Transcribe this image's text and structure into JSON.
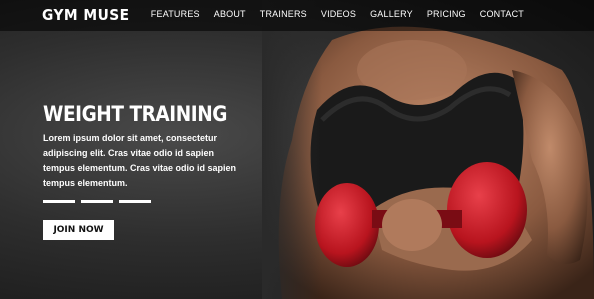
{
  "brand": {
    "name": "GYM MUSE"
  },
  "nav": {
    "items": [
      {
        "label": "FEATURES"
      },
      {
        "label": "ABOUT"
      },
      {
        "label": "TRAINERS"
      },
      {
        "label": "VIDEOS"
      },
      {
        "label": "GALLERY"
      },
      {
        "label": "PRICING"
      },
      {
        "label": "CONTACT"
      }
    ]
  },
  "hero": {
    "title": "WEIGHT TRAINING",
    "description": "Lorem ipsum dolor sit amet, consectetur adipiscing elit. Cras vitae odio id sapien tempus elementum. Cras vitae odio id sapien tempus elementum.",
    "cta_label": "JOIN NOW",
    "slides": 3
  },
  "colors": {
    "accent": "#ffffff",
    "dumbbell": "#c8202a",
    "background": "#1f1f1f"
  }
}
